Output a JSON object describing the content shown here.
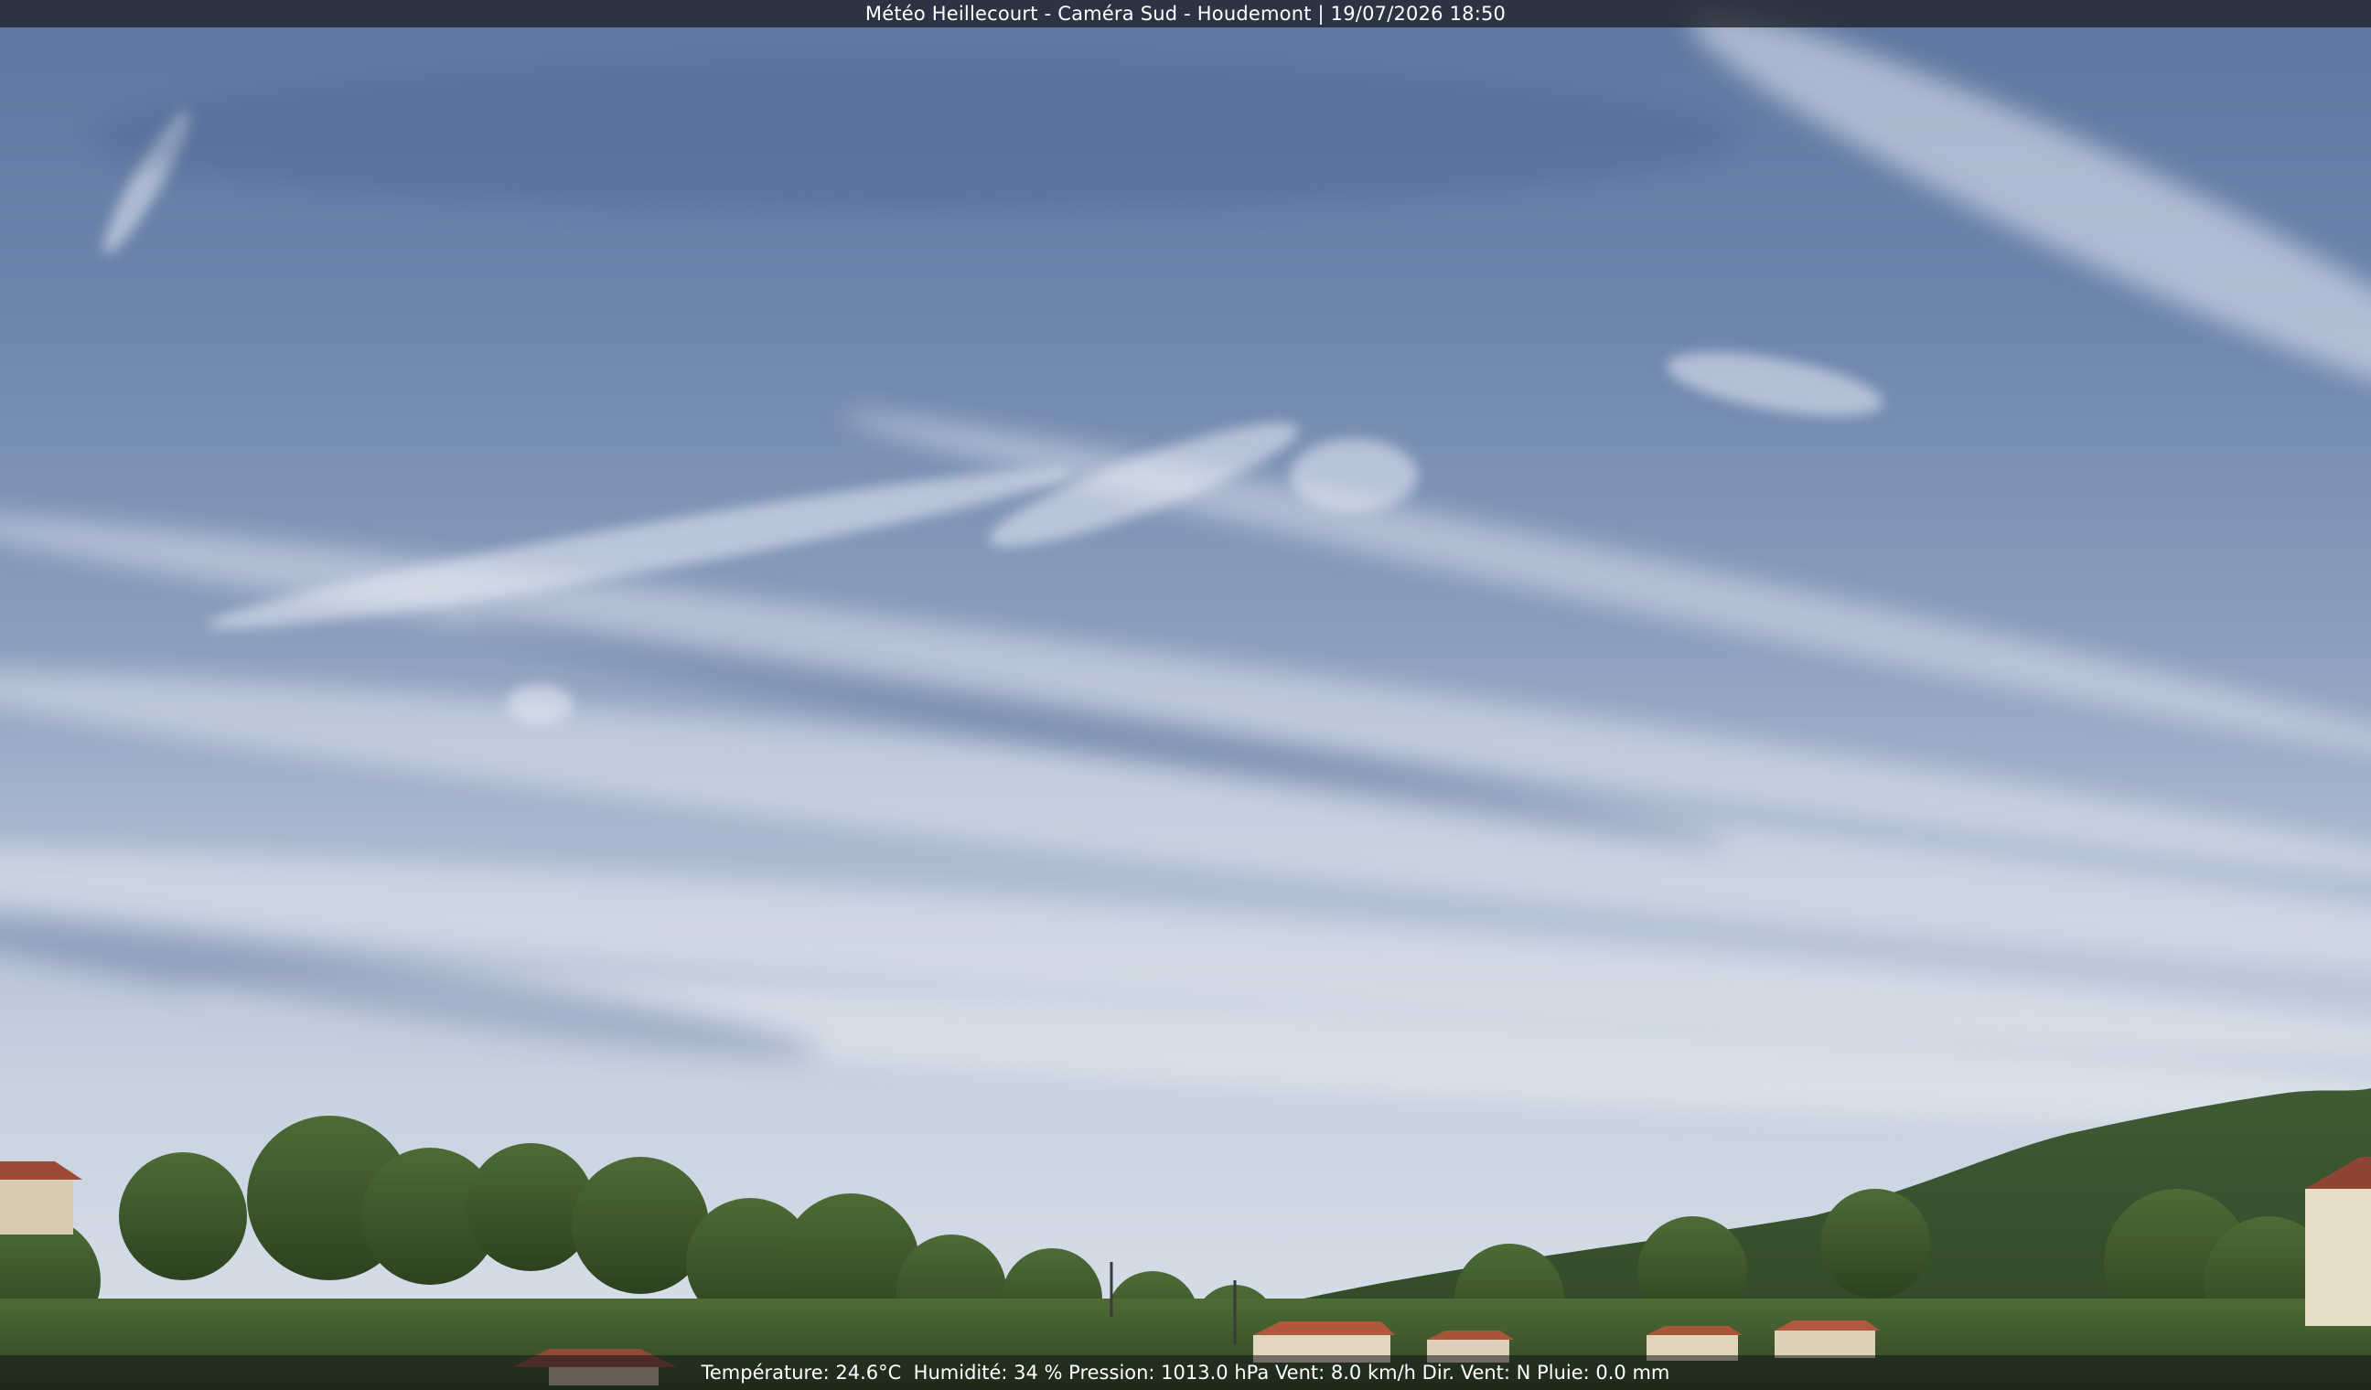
{
  "caption": {
    "title": "Météo Heillecourt - Caméra Sud - Houdemont | 19/07/2026 18:50"
  },
  "readings": {
    "temperature": "Température: 24.6°C",
    "humidity": "Humidité: 34 %",
    "pressure": "Pression: 1013.0 hPa",
    "wind": "Vent: 8.0 km/h",
    "wind_dir": "Dir. Vent: N",
    "rain": "Pluie: 0.0 mm"
  },
  "colors": {
    "sky_top": "#5f76a0",
    "sky_bottom": "#d9e0ea",
    "foliage": "#3d5a2c",
    "roof": "#b0583e"
  }
}
